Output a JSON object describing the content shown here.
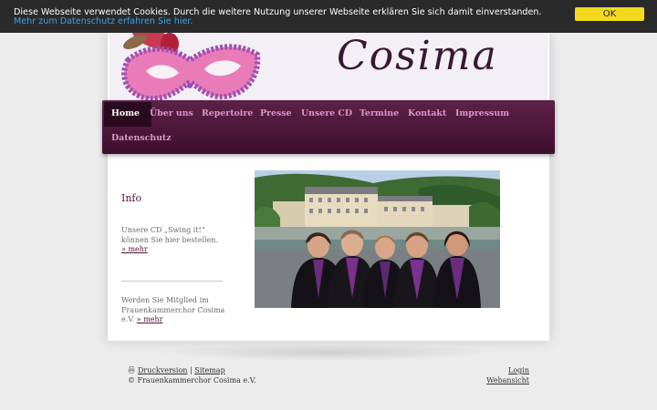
{
  "cookie_bar": {
    "text": "Diese Webseite verwendet Cookies. Durch die weitere Nutzung unserer Webseite erklären Sie sich damit einverstanden.",
    "link_text": "Mehr zum Datenschutz erfahren Sie hier.",
    "ok_label": "OK"
  },
  "header": {
    "logo_text": "Cosima",
    "mask_icon": "carnival-mask-icon"
  },
  "nav": {
    "items": [
      {
        "label": "Home",
        "active": true
      },
      {
        "label": "Über uns",
        "active": false
      },
      {
        "label": "Repertoire",
        "active": false
      },
      {
        "label": "Presse",
        "active": false
      },
      {
        "label": "Unsere CD",
        "active": false
      },
      {
        "label": "Termine",
        "active": false
      },
      {
        "label": "Kontakt",
        "active": false
      },
      {
        "label": "Impressum",
        "active": false
      },
      {
        "label": "Datenschutz",
        "active": false
      }
    ]
  },
  "sidebar": {
    "title": "Info",
    "cd_text": "Unsere CD „Swing it!“ können Sie hier bestellen.",
    "cd_link": "» mehr",
    "member_text": "Werden Sie Mitglied im Frauenkammerchor Cosima e.V.",
    "member_link": "» mehr"
  },
  "footer": {
    "print_label": "Druckversion",
    "separator": "|",
    "sitemap_label": "Sitemap",
    "copyright": "© Frauenkammerchor Cosima e.V.",
    "login_label": "Login",
    "webview_label": "Webansicht"
  },
  "colors": {
    "nav_top": "#5e2049",
    "nav_bottom": "#3d0f2c",
    "nav_text": "#d898c8",
    "accent": "#4a1438",
    "cookie_button": "#f3da1f",
    "cookie_link": "#39a2f0"
  }
}
